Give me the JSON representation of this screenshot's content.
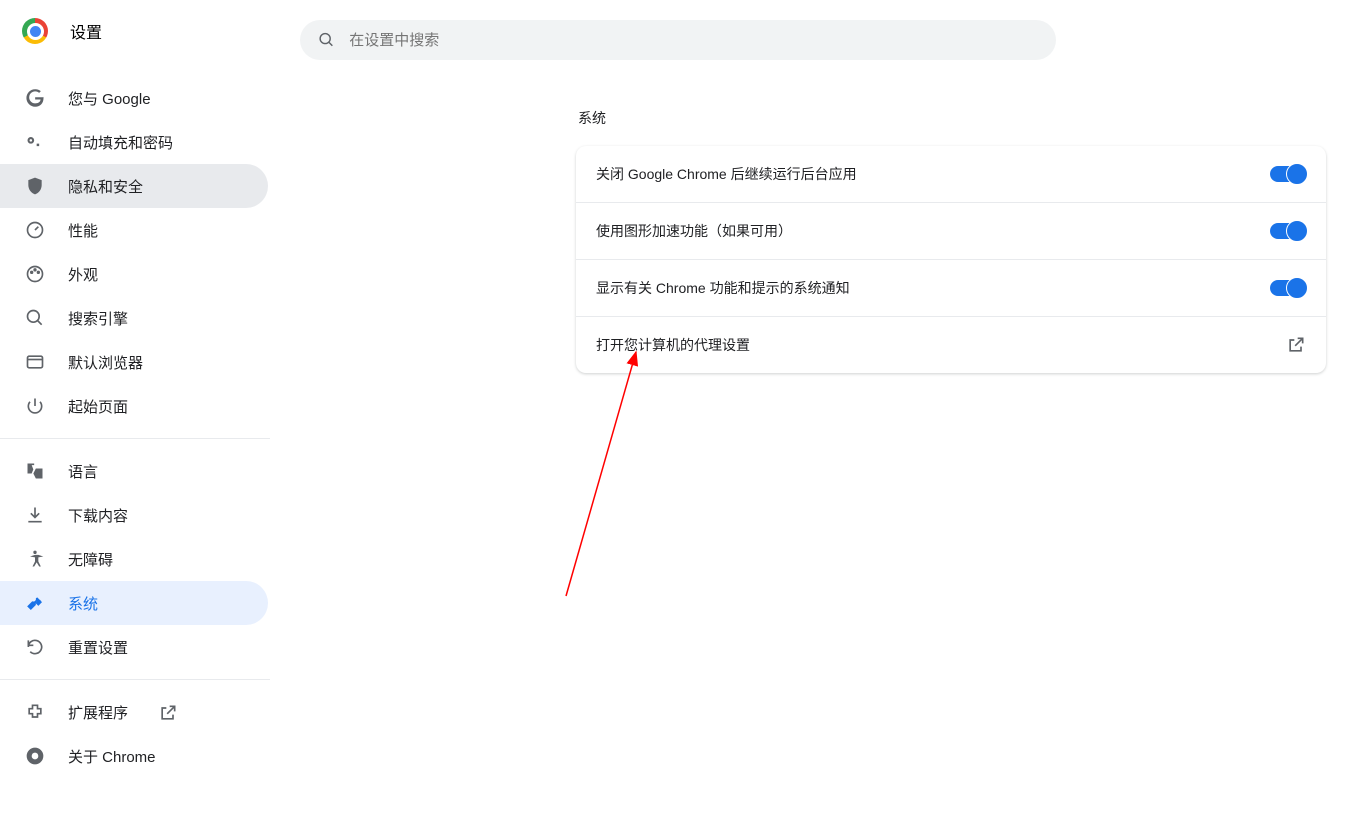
{
  "header": {
    "title": "设置"
  },
  "search": {
    "placeholder": "在设置中搜索"
  },
  "sidebar": {
    "group1": [
      {
        "label": "您与 Google",
        "icon": "google"
      },
      {
        "label": "自动填充和密码",
        "icon": "key"
      },
      {
        "label": "隐私和安全",
        "icon": "shield",
        "sel": "privacy"
      },
      {
        "label": "性能",
        "icon": "speed"
      },
      {
        "label": "外观",
        "icon": "palette"
      },
      {
        "label": "搜索引擎",
        "icon": "search"
      },
      {
        "label": "默认浏览器",
        "icon": "browser"
      },
      {
        "label": "起始页面",
        "icon": "power"
      }
    ],
    "group2": [
      {
        "label": "语言",
        "icon": "translate"
      },
      {
        "label": "下载内容",
        "icon": "download"
      },
      {
        "label": "无障碍",
        "icon": "accessibility"
      },
      {
        "label": "系统",
        "icon": "wrench",
        "sel": "system"
      },
      {
        "label": "重置设置",
        "icon": "reset"
      }
    ],
    "group3": [
      {
        "label": "扩展程序",
        "icon": "extension",
        "ext": true
      },
      {
        "label": "关于 Chrome",
        "icon": "chrome"
      }
    ]
  },
  "main": {
    "section_title": "系统",
    "rows": [
      {
        "label": "关闭 Google Chrome 后继续运行后台应用",
        "type": "toggle",
        "on": true
      },
      {
        "label": "使用图形加速功能（如果可用）",
        "type": "toggle",
        "on": true
      },
      {
        "label": "显示有关 Chrome 功能和提示的系统通知",
        "type": "toggle",
        "on": true
      },
      {
        "label": "打开您计算机的代理设置",
        "type": "external"
      }
    ]
  }
}
